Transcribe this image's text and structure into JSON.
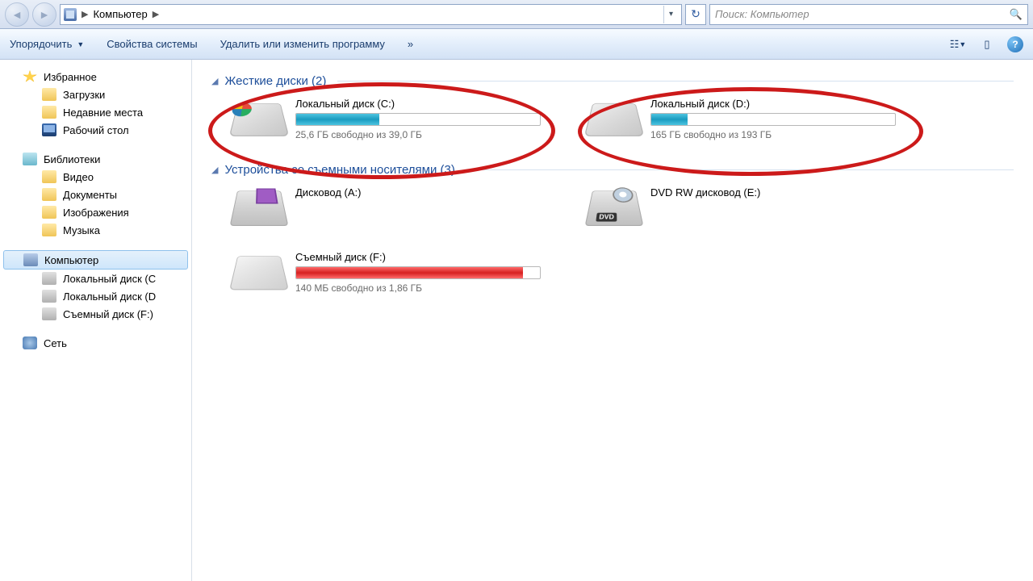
{
  "address": {
    "location": "Компьютер"
  },
  "search": {
    "placeholder": "Поиск: Компьютер"
  },
  "toolbar": {
    "organize": "Упорядочить",
    "properties": "Свойства системы",
    "uninstall": "Удалить или изменить программу",
    "more": "»"
  },
  "sidebar": {
    "favorites": "Избранное",
    "downloads": "Загрузки",
    "recent": "Недавние места",
    "desktop": "Рабочий стол",
    "libraries": "Библиотеки",
    "video": "Видео",
    "documents": "Документы",
    "pictures": "Изображения",
    "music": "Музыка",
    "computer": "Компьютер",
    "drive_c": "Локальный диск  (C",
    "drive_d": "Локальный диск (D",
    "drive_f": "Съемный диск (F:)",
    "network": "Сеть"
  },
  "groups": {
    "hdd": "Жесткие диски (2)",
    "removable": "Устройства со съемными носителями (3)"
  },
  "drives": {
    "c": {
      "name": "Локальный диск  (C:)",
      "status": "25,6 ГБ свободно из 39,0 ГБ",
      "fill_pct": 34
    },
    "d": {
      "name": "Локальный диск (D:)",
      "status": "165 ГБ свободно из 193 ГБ",
      "fill_pct": 15
    },
    "a": {
      "name": "Дисковод (A:)"
    },
    "e": {
      "name": "DVD RW дисковод (E:)"
    },
    "f": {
      "name": "Съемный диск (F:)",
      "status": "140 МБ свободно из 1,86 ГБ",
      "fill_pct": 93
    }
  }
}
